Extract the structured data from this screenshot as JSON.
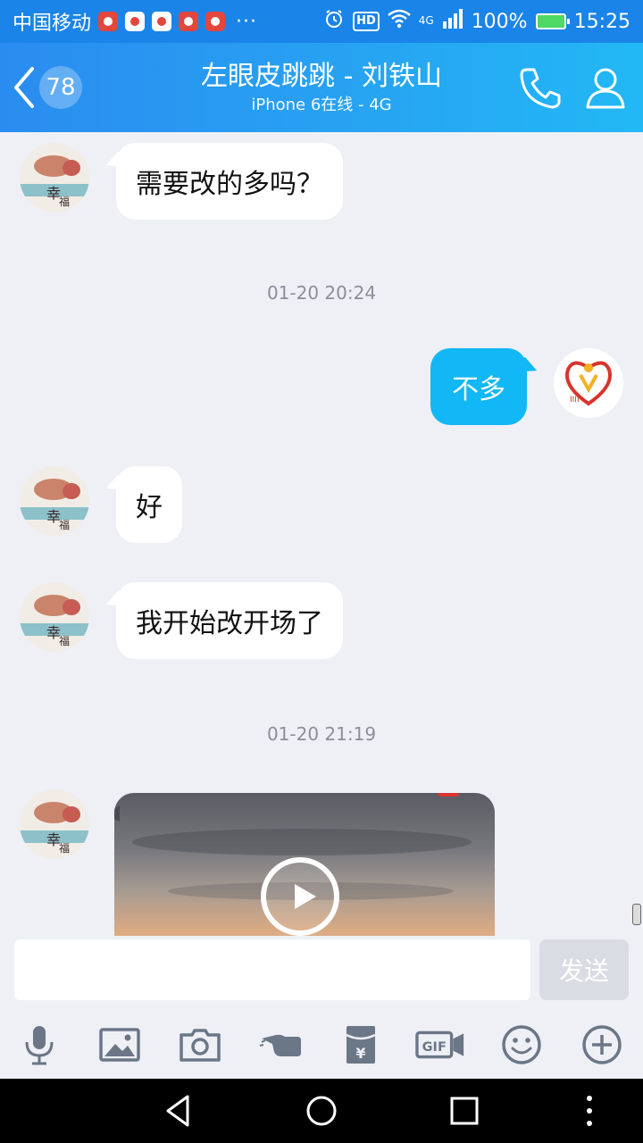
{
  "status_bar": {
    "carrier": "中国移动",
    "more": "···",
    "hd": "HD",
    "network": "4G",
    "battery": "100%",
    "time": "15:25"
  },
  "header": {
    "unread_count": "78",
    "title": "左眼皮跳跳 - 刘铁山",
    "subtitle": "iPhone 6在线 - 4G"
  },
  "messages": [
    {
      "side": "left",
      "text": "需要改的多吗？"
    },
    {
      "type": "time",
      "text": "01-20 20:24"
    },
    {
      "side": "right",
      "text": "不多"
    },
    {
      "side": "left",
      "text": "好"
    },
    {
      "side": "left",
      "text": "我开始改开场了"
    },
    {
      "type": "time",
      "text": "01-20 21:19"
    },
    {
      "side": "left",
      "type": "video"
    }
  ],
  "input": {
    "value": "",
    "placeholder": "",
    "send_label": "发送"
  },
  "toolbar": {
    "items": [
      "microphone-icon",
      "image-icon",
      "camera-icon",
      "poke-icon",
      "red-packet-icon",
      "gif-icon",
      "emoji-icon",
      "plus-icon"
    ],
    "gif_label": "GIF"
  },
  "colors": {
    "header_start": "#2a8cf0",
    "header_end": "#22b8f5",
    "sent_bubble": "#12b7f5",
    "chat_bg": "#eef0f6"
  }
}
